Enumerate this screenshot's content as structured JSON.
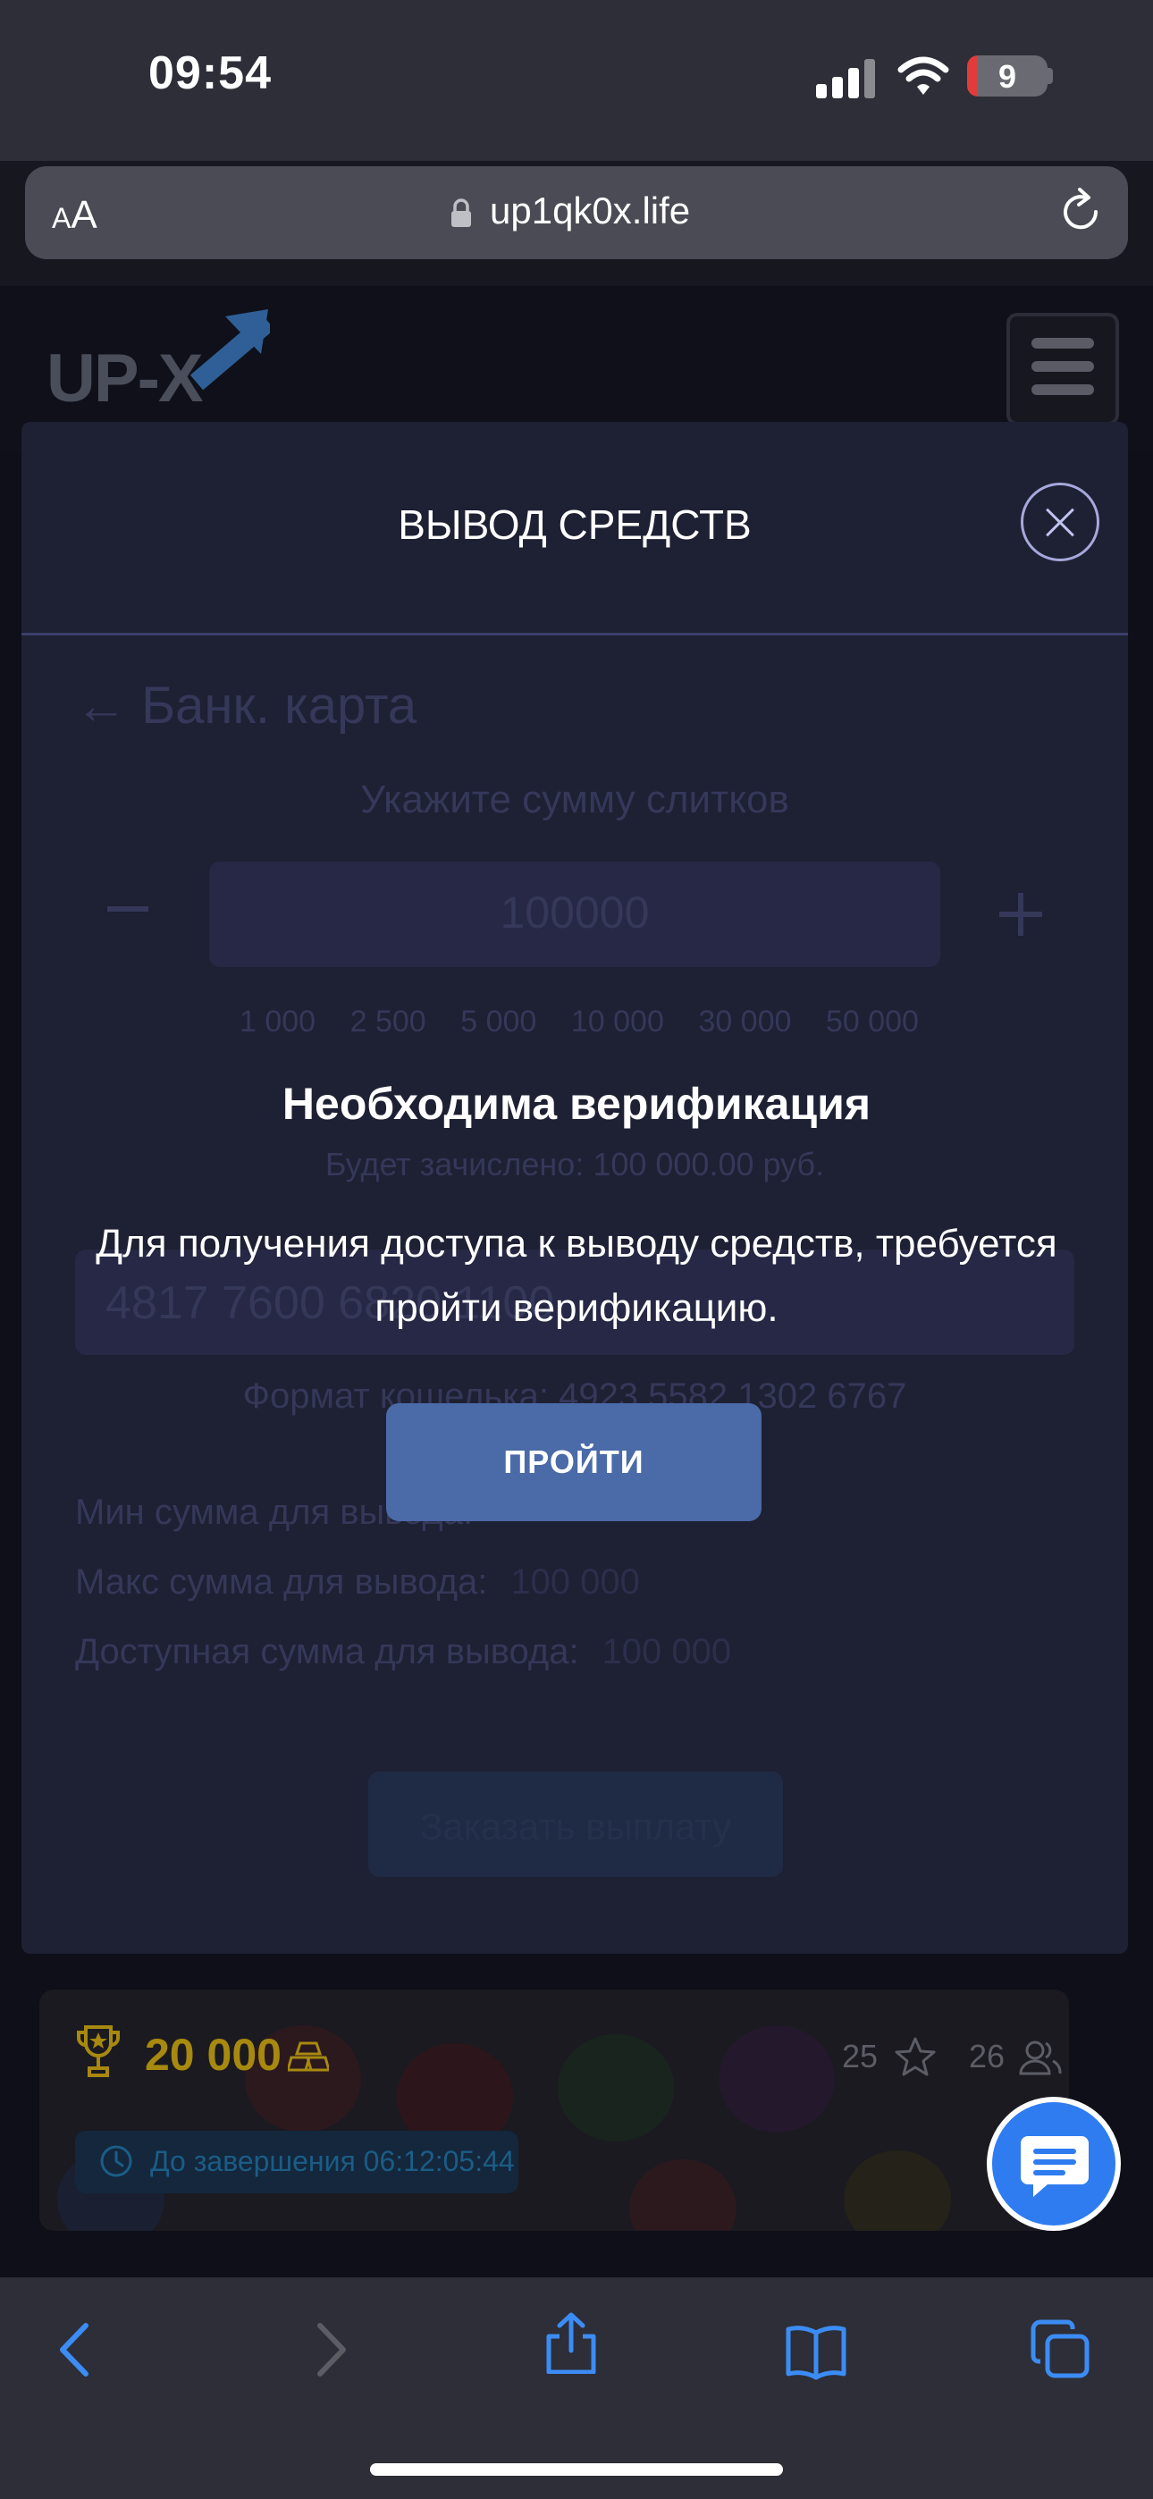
{
  "status_bar": {
    "time": "09:54",
    "battery": "9",
    "battery_color": "#e23b3b"
  },
  "browser": {
    "text_size_label": "AA",
    "url": "up1qk0x.life"
  },
  "site": {
    "logo_text": "UP-X",
    "menu_icon": "hamburger-menu-icon"
  },
  "dialog": {
    "title": "ВЫВОД СРЕДСТВ",
    "back_label": "← Банк. карта",
    "amount_label": "Укажите сумму слитков",
    "amount_value": "100000",
    "minus_label": "−",
    "plus_label": "+",
    "presets": [
      "1 000",
      "2 500",
      "5 000",
      "10 000",
      "30 000",
      "50 000"
    ],
    "credit_text": "Будет зачислено: 100 000.00 руб.",
    "card_value": "4817 7600 6820 1100",
    "wallet_format": "Формат кошелька: 4923 5582 1302 6767",
    "min_label": "Мин сумма для вывода:",
    "max_label": "Макс сумма для вывода:",
    "max_value": "100 000",
    "available_label": "Доступная сумма для вывода:",
    "available_value": "100 000",
    "order_button": "Заказать выплату"
  },
  "verification": {
    "title": "Необходима верификация",
    "text": "Для получения доступа к выводу средств, требуется пройти верификацию.",
    "button": "ПРОЙТИ",
    "button_color": "#4a6aa8"
  },
  "tournament": {
    "prize": "20 000",
    "stars_count": "25",
    "participants_count": "26",
    "timer_text": "До завершения 06:12:05:44",
    "prize_color": "#a7890f"
  },
  "colors": {
    "accent_blue": "#2f7cf0",
    "dialog_bg": "#1e2033",
    "page_bg": "#0e0f18"
  }
}
